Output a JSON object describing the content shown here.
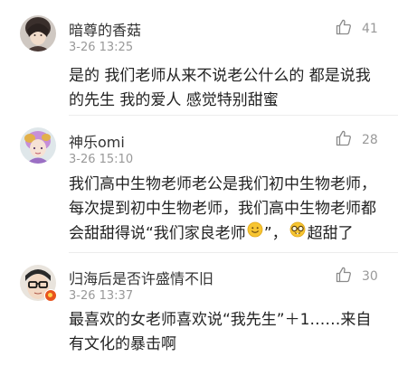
{
  "comments": [
    {
      "username": "暗尊的香菇",
      "time": "3-26 13:25",
      "likes": "41",
      "text": "是的 我们老师从来不说老公什么的 都是说我的先生 我的爱人 感觉特别甜蜜"
    },
    {
      "username": "神乐omi",
      "time": "3-26 15:10",
      "likes": "28",
      "text_part1": "我们高中生物老师老公是我们初中生物老师，每次提到初中生物老师，我们高中生物老师都会甜甜得说“我们家良老师",
      "text_part2": "”，",
      "text_part3": "超甜了",
      "emoji1": "smile-emoji",
      "emoji2": "nerd-glasses-emoji"
    },
    {
      "username": "归海后是否许盛情不旧",
      "time": "3-26 13:37",
      "likes": "30",
      "text": "最喜欢的女老师喜欢说“我先生”＋1……来自有文化的暴击啊"
    }
  ],
  "colors": {
    "name": "#333333",
    "meta": "#999999",
    "text": "#222222",
    "badge": "#e8541e"
  },
  "icons": {
    "like": "thumbs-up-icon"
  }
}
